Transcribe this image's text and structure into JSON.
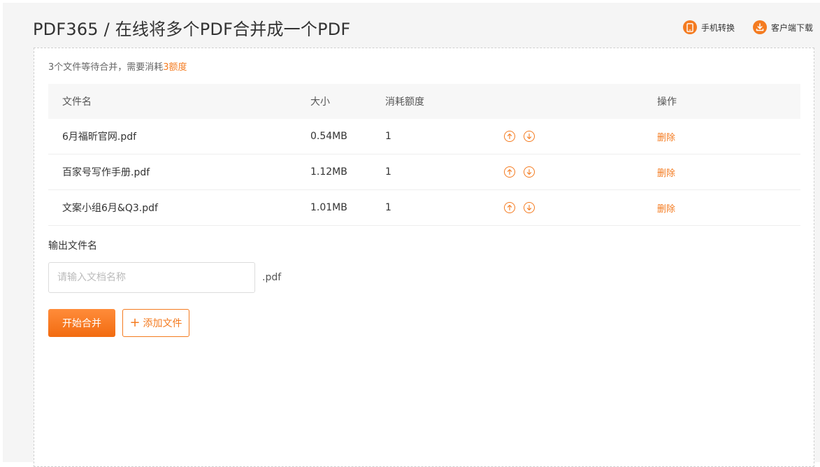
{
  "header": {
    "title": "PDF365 / 在线将多个PDF合并成一个PDF",
    "links": [
      {
        "label": "手机转换",
        "icon": "phone-icon"
      },
      {
        "label": "客户端下载",
        "icon": "download-icon"
      }
    ]
  },
  "summary": {
    "prefix": "3个文件等待合并，需要消耗",
    "credits": "3额度"
  },
  "table": {
    "columns": [
      "文件名",
      "大小",
      "消耗额度",
      "",
      "操作"
    ],
    "rows": [
      {
        "name": "6月福昕官网.pdf",
        "size": "0.54MB",
        "credit": "1",
        "action": "删除"
      },
      {
        "name": "百家号写作手册.pdf",
        "size": "1.12MB",
        "credit": "1",
        "action": "删除"
      },
      {
        "name": "文案小组6月&Q3.pdf",
        "size": "1.01MB",
        "credit": "1",
        "action": "删除"
      }
    ]
  },
  "output": {
    "label": "输出文件名",
    "value": "",
    "placeholder": "请输入文档名称",
    "extension": ".pdf"
  },
  "actions": {
    "merge_label": "开始合并",
    "add_label": "添加文件"
  },
  "colors": {
    "accent": "#f47b20",
    "background": "#f5f5f5"
  }
}
